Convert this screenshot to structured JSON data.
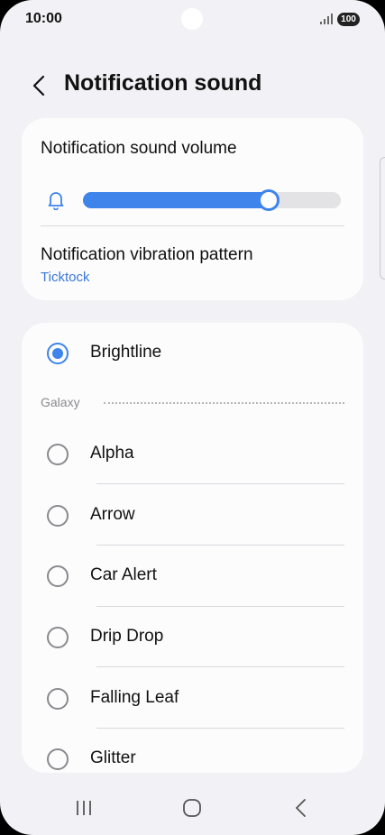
{
  "status_bar": {
    "time": "10:00",
    "battery": "100",
    "icons": [
      "signal-icon",
      "battery-icon",
      "camera-cutout"
    ]
  },
  "header": {
    "title": "Notification sound",
    "back_icon": "chevron-left-icon"
  },
  "volume": {
    "label": "Notification sound volume",
    "icon": "bell-icon",
    "level": 0.72
  },
  "vibration": {
    "label": "Notification vibration pattern",
    "value": "Ticktock"
  },
  "sounds": {
    "selected": "Brightline",
    "section_title": "Galaxy",
    "items": [
      {
        "label": "Alpha",
        "selected": false
      },
      {
        "label": "Arrow",
        "selected": false
      },
      {
        "label": "Car Alert",
        "selected": false
      },
      {
        "label": "Drip Drop",
        "selected": false
      },
      {
        "label": "Falling Leaf",
        "selected": false
      },
      {
        "label": "Glitter",
        "selected": false
      }
    ]
  },
  "nav_bar": {
    "icons": [
      "recent-apps-icon",
      "home-icon",
      "back-icon"
    ]
  },
  "colors": {
    "accent": "#3e84ea",
    "link": "#3a78d6",
    "background": "#f2f2f6",
    "card": "#fcfcfd"
  }
}
